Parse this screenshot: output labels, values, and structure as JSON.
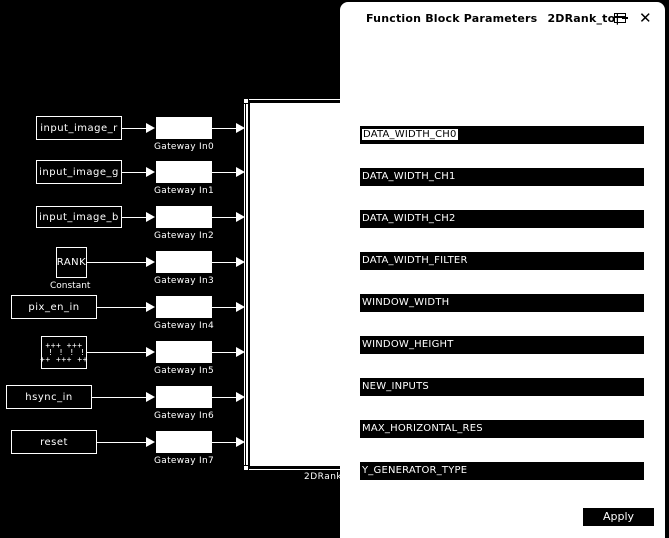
{
  "diagram": {
    "sources": [
      {
        "label": "input_image_r",
        "type": "inport"
      },
      {
        "label": "input_image_g",
        "type": "inport"
      },
      {
        "label": "input_image_b",
        "type": "inport"
      },
      {
        "label": "RANK",
        "type": "constant",
        "caption": "Constant"
      },
      {
        "label": "pix_en_in",
        "type": "inport"
      },
      {
        "label": "+++ +++\n ! ! ! !\n++ +++ ++",
        "type": "pattern-source"
      },
      {
        "label": "hsync_in",
        "type": "inport"
      },
      {
        "label": "reset",
        "type": "inport"
      }
    ],
    "gateways": [
      "Gateway In0",
      "Gateway In1",
      "Gateway In2",
      "Gateway In3",
      "Gateway In4",
      "Gateway In5",
      "Gateway In6",
      "Gateway In7"
    ],
    "main_block_label": "2DRank"
  },
  "dialog": {
    "title": "Function Block Parameters",
    "block_name": "2DRank_to|",
    "params": [
      "DATA_WIDTH_CH0",
      "DATA_WIDTH_CH1",
      "DATA_WIDTH_CH2",
      "DATA_WIDTH_FILTER",
      "WINDOW_WIDTH",
      "WINDOW_HEIGHT",
      "NEW_INPUTS",
      "MAX_HORIZONTAL_RES",
      "Y_GENERATOR_TYPE"
    ],
    "apply_label": "Apply",
    "icons": {
      "undock": "undock-icon",
      "close": "close-icon"
    }
  }
}
